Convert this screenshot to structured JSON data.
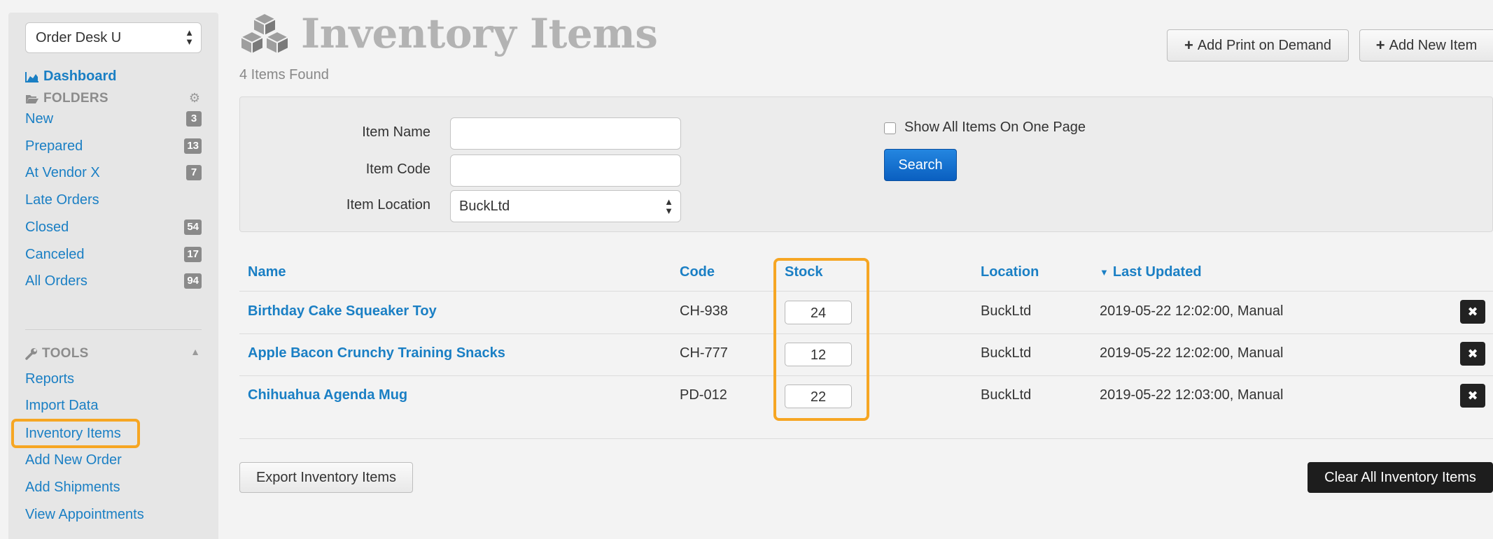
{
  "sidebar": {
    "store_select": "Order Desk U",
    "dashboard": "Dashboard",
    "folders_heading": "FOLDERS",
    "folders": [
      {
        "label": "New",
        "count": "3"
      },
      {
        "label": "Prepared",
        "count": "13"
      },
      {
        "label": "At Vendor X",
        "count": "7"
      },
      {
        "label": "Late Orders",
        "count": ""
      },
      {
        "label": "Closed",
        "count": "54"
      },
      {
        "label": "Canceled",
        "count": "17"
      },
      {
        "label": "All Orders",
        "count": "94"
      }
    ],
    "tools_heading": "TOOLS",
    "tools": [
      {
        "label": "Reports"
      },
      {
        "label": "Import Data"
      },
      {
        "label": "Inventory Items"
      },
      {
        "label": "Add New Order"
      },
      {
        "label": "Add Shipments"
      },
      {
        "label": "View Appointments"
      }
    ]
  },
  "header": {
    "title": "Inventory Items",
    "items_found": "4 Items Found",
    "add_print_on_demand": "Add Print on Demand",
    "add_new_item": "Add New Item"
  },
  "filters": {
    "item_name_label": "Item Name",
    "item_name_value": "",
    "item_code_label": "Item Code",
    "item_code_value": "",
    "item_location_label": "Item Location",
    "item_location_value": "BuckLtd",
    "show_all_label": "Show All Items On One Page",
    "search_label": "Search"
  },
  "table": {
    "headers": {
      "name": "Name",
      "code": "Code",
      "stock": "Stock",
      "location": "Location",
      "last_updated": "Last Updated"
    },
    "rows": [
      {
        "name": "Birthday Cake Squeaker Toy",
        "code": "CH-938",
        "stock": "24",
        "location": "BuckLtd",
        "updated": "2019-05-22 12:02:00, Manual"
      },
      {
        "name": "Apple Bacon Crunchy Training Snacks",
        "code": "CH-777",
        "stock": "12",
        "location": "BuckLtd",
        "updated": "2019-05-22 12:02:00, Manual"
      },
      {
        "name": "Chihuahua Agenda Mug",
        "code": "PD-012",
        "stock": "22",
        "location": "BuckLtd",
        "updated": "2019-05-22 12:03:00, Manual"
      }
    ]
  },
  "footer": {
    "export": "Export Inventory Items",
    "clear_all": "Clear All Inventory Items"
  },
  "colors": {
    "link": "#1a7fc4",
    "highlight": "#f6a623",
    "search_button": "#0a6fd0",
    "danger_button": "#1d1d1d"
  }
}
